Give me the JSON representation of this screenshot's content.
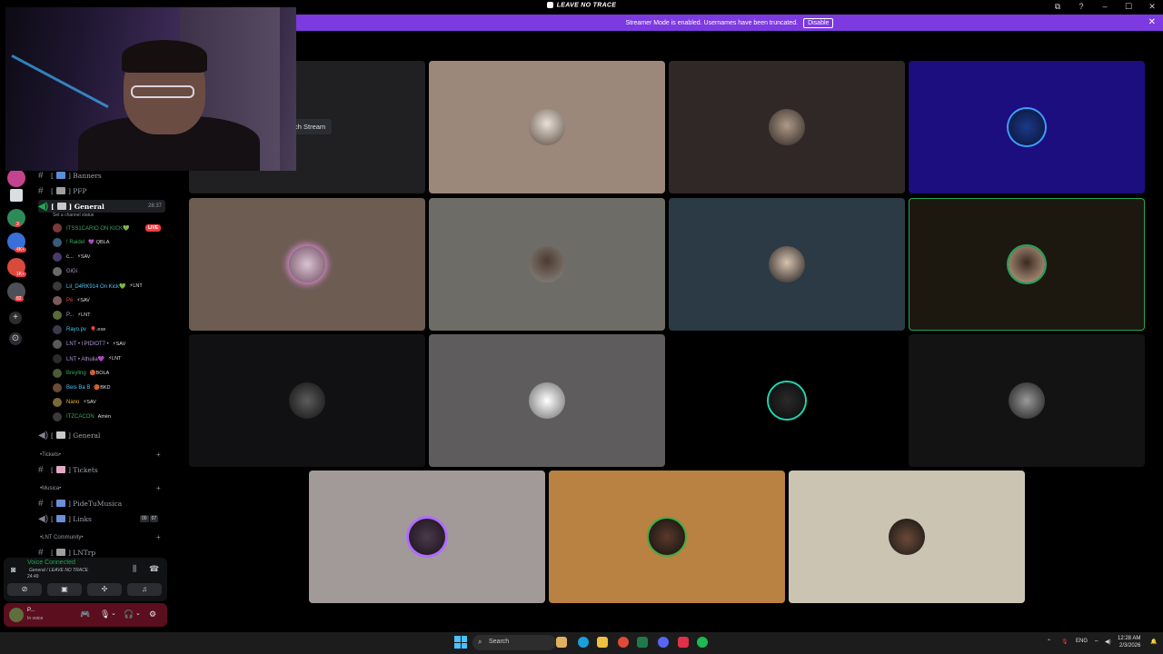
{
  "window": {
    "title": "LEAVE NO TRACE",
    "controls": [
      "⧉",
      "?",
      "–",
      "☐",
      "✕"
    ]
  },
  "banner": {
    "text": "Streamer Mode is enabled. Usernames have been truncated.",
    "button": "Disable",
    "close": "✕"
  },
  "stage": {
    "watch_stream_label": "ch Stream"
  },
  "rail": {
    "badges": [
      "3",
      "4K+",
      "1K+",
      "82"
    ],
    "add": "+",
    "discover": "⊙"
  },
  "channels": {
    "banners": "Banners",
    "pfp": "PFP",
    "general_active": "General",
    "general_active_time": "28:37",
    "set_status": "Set a channel status",
    "voice_users": [
      {
        "name": "ITSS1CARIO ON KICK💚",
        "tag": "",
        "live": "LIVE",
        "color": "#3ba55d"
      },
      {
        "name": "! Raidel",
        "tag": "💜 QBLA",
        "color": "#3ba55d"
      },
      {
        "name": "c...",
        "tag": "⚡SAV",
        "color": "#dbdee1"
      },
      {
        "name": "GiGi",
        "tag": "",
        "color": "#b19cd9"
      },
      {
        "name": "Lil_D4RK914 On Kick💚",
        "tag": "⚡LNT",
        "color": "#4fc3f7"
      },
      {
        "name": "Pé",
        "tag": "⚡SAV",
        "color": "#f23f43"
      },
      {
        "name": "P...",
        "tag": "⚡LNT",
        "color": "#b19cd9"
      },
      {
        "name": "Rayo.pv",
        "tag": "🎈.exe",
        "color": "#4fc3f7"
      },
      {
        "name": "LNT • l PIDIOT7 •",
        "tag": "⚡SAV",
        "color": "#b19cd9"
      },
      {
        "name": "LNT • Athulia💜",
        "tag": "⚡LNT",
        "color": "#b19cd9"
      },
      {
        "name": "Breyling",
        "tag": "🏀BOLA",
        "color": "#3ba55d"
      },
      {
        "name": "Beis Ba B",
        "tag": "🏀BKD",
        "color": "#4fc3f7"
      },
      {
        "name": "Nano",
        "tag": "⚡SAV",
        "color": "#f0b232"
      },
      {
        "name": "ITZCACON",
        "tag": "Amén",
        "color": "#3ba55d"
      }
    ],
    "general_second": "General",
    "tickets_cat": "Tickets",
    "tickets": "Tickets",
    "musica_cat": "Musica",
    "pidetumusica": "PideTuMusica",
    "links": "Links",
    "links_pills": [
      "00",
      "07"
    ],
    "community_cat": "LNT Community",
    "lntrp": "LNTrp",
    "plus": "+"
  },
  "voice_panel": {
    "status": "Voice Connected",
    "channel": "General / LEAVE NO TRACE",
    "timer": "24:49"
  },
  "user_panel": {
    "name": "P...",
    "status": "In voice"
  },
  "taskbar": {
    "search": "Search",
    "lang": "ENG",
    "time": "12:28 AM",
    "date": "2/3/2026"
  },
  "colors": {
    "banner": "#7c3ae0",
    "speaking": "#23a55a",
    "voice_connected": "#23a55a",
    "user_panel_bg": "#5a0e1e"
  }
}
